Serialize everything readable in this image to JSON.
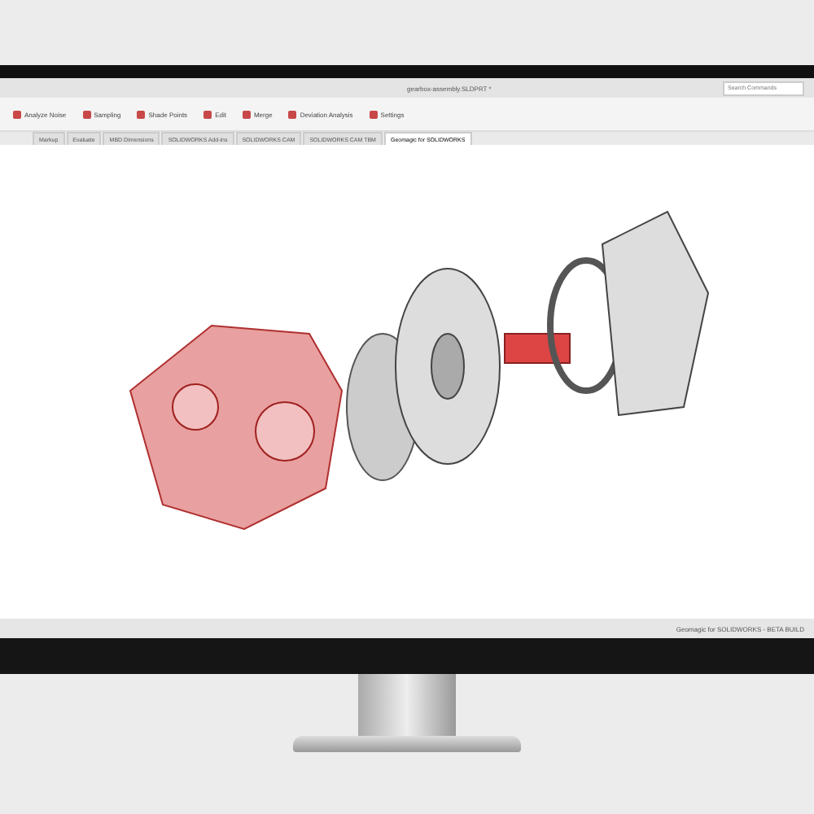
{
  "window": {
    "title": "gearbox-assembly.SLDPRT *"
  },
  "search": {
    "placeholder": "Search Commands"
  },
  "ribbon": [
    {
      "label": "Analyze Noise"
    },
    {
      "label": "Sampling"
    },
    {
      "label": "Shade Points"
    },
    {
      "label": "Edit"
    },
    {
      "label": "Merge"
    },
    {
      "label": "Deviation Analysis"
    },
    {
      "label": "Settings"
    }
  ],
  "tabs": [
    {
      "label": "Markup",
      "selected": false
    },
    {
      "label": "Evaluate",
      "selected": false
    },
    {
      "label": "MBD Dimensions",
      "selected": false
    },
    {
      "label": "SOLIDWORKS Add-ins",
      "selected": false
    },
    {
      "label": "SOLIDWORKS CAM",
      "selected": false
    },
    {
      "label": "SOLIDWORKS CAM TBM",
      "selected": false
    },
    {
      "label": "Geomagic for SOLIDWORKS",
      "selected": true
    }
  ],
  "status_bar": {
    "text": "Geomagic for SOLIDWORKS - BETA BUILD"
  }
}
